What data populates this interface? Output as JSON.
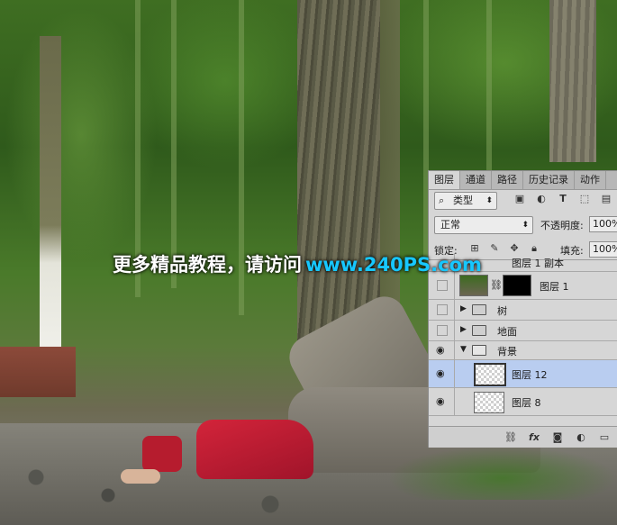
{
  "watermark": {
    "text": "更多精品教程，请访问",
    "url": "www.240PS.com"
  },
  "layers_panel": {
    "tabs": [
      "图层",
      "通道",
      "路径",
      "历史记录",
      "动作"
    ],
    "filter": {
      "kind_label": "类型",
      "icons": [
        "image-filter-icon",
        "adjustment-filter-icon",
        "type-filter-icon",
        "shape-filter-icon",
        "smart-object-filter-icon"
      ]
    },
    "blend_mode": "正常",
    "opacity_label": "不透明度:",
    "opacity_value": "100%",
    "lock_label": "锁定:",
    "fill_label": "填充:",
    "fill_value": "100%",
    "layers": [
      {
        "name": "图层 1 副本",
        "visible": false
      },
      {
        "name": "图层 1",
        "visible": false,
        "has_mask": true
      },
      {
        "name": "树",
        "type": "group",
        "visible": false,
        "expanded": false
      },
      {
        "name": "地面",
        "type": "group",
        "visible": false,
        "expanded": false
      },
      {
        "name": "背景",
        "type": "group",
        "visible": true,
        "expanded": true
      },
      {
        "name": "图层 12",
        "visible": true,
        "selected": true
      },
      {
        "name": "图层 8",
        "visible": true
      }
    ],
    "bottom_icons": [
      "link-layers-icon",
      "fx-icon",
      "add-mask-icon",
      "adjustment-layer-icon",
      "new-group-icon"
    ]
  }
}
